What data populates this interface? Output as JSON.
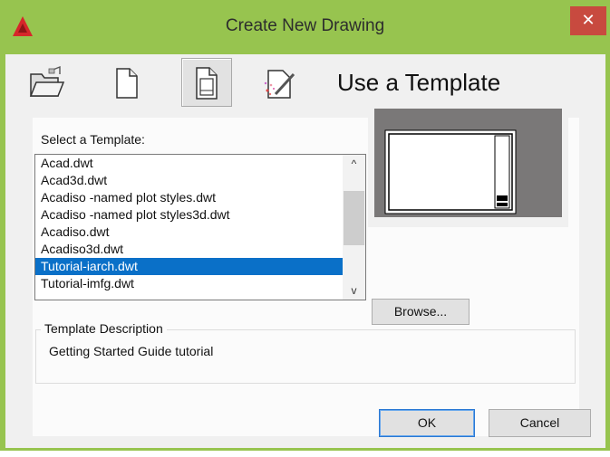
{
  "window": {
    "title": "Create New Drawing",
    "close_glyph": "✕"
  },
  "toolbar": {
    "buttons": [
      {
        "icon": "open-folder-icon"
      },
      {
        "icon": "blank-page-icon"
      },
      {
        "icon": "template-page-icon",
        "active": true
      },
      {
        "icon": "wizard-icon"
      }
    ],
    "heading": "Use a Template"
  },
  "template_list": {
    "label": "Select a Template:",
    "items": [
      "Acad.dwt",
      "Acad3d.dwt",
      "Acadiso -named plot styles.dwt",
      "Acadiso -named plot styles3d.dwt",
      "Acadiso.dwt",
      "Acadiso3d.dwt",
      "Tutorial-iarch.dwt",
      "Tutorial-imfg.dwt"
    ],
    "selected_index": 6,
    "scroll_up": "^",
    "scroll_down": "v"
  },
  "preview": {
    "icon": "template-preview-thumbnail"
  },
  "browse_label": "Browse...",
  "description": {
    "title": "Template Description",
    "text": "Getting Started Guide tutorial"
  },
  "buttons": {
    "ok": "OK",
    "cancel": "Cancel"
  },
  "colors": {
    "title_bar": "#97c44f",
    "close": "#c84a3f",
    "selection": "#0a70c8"
  }
}
